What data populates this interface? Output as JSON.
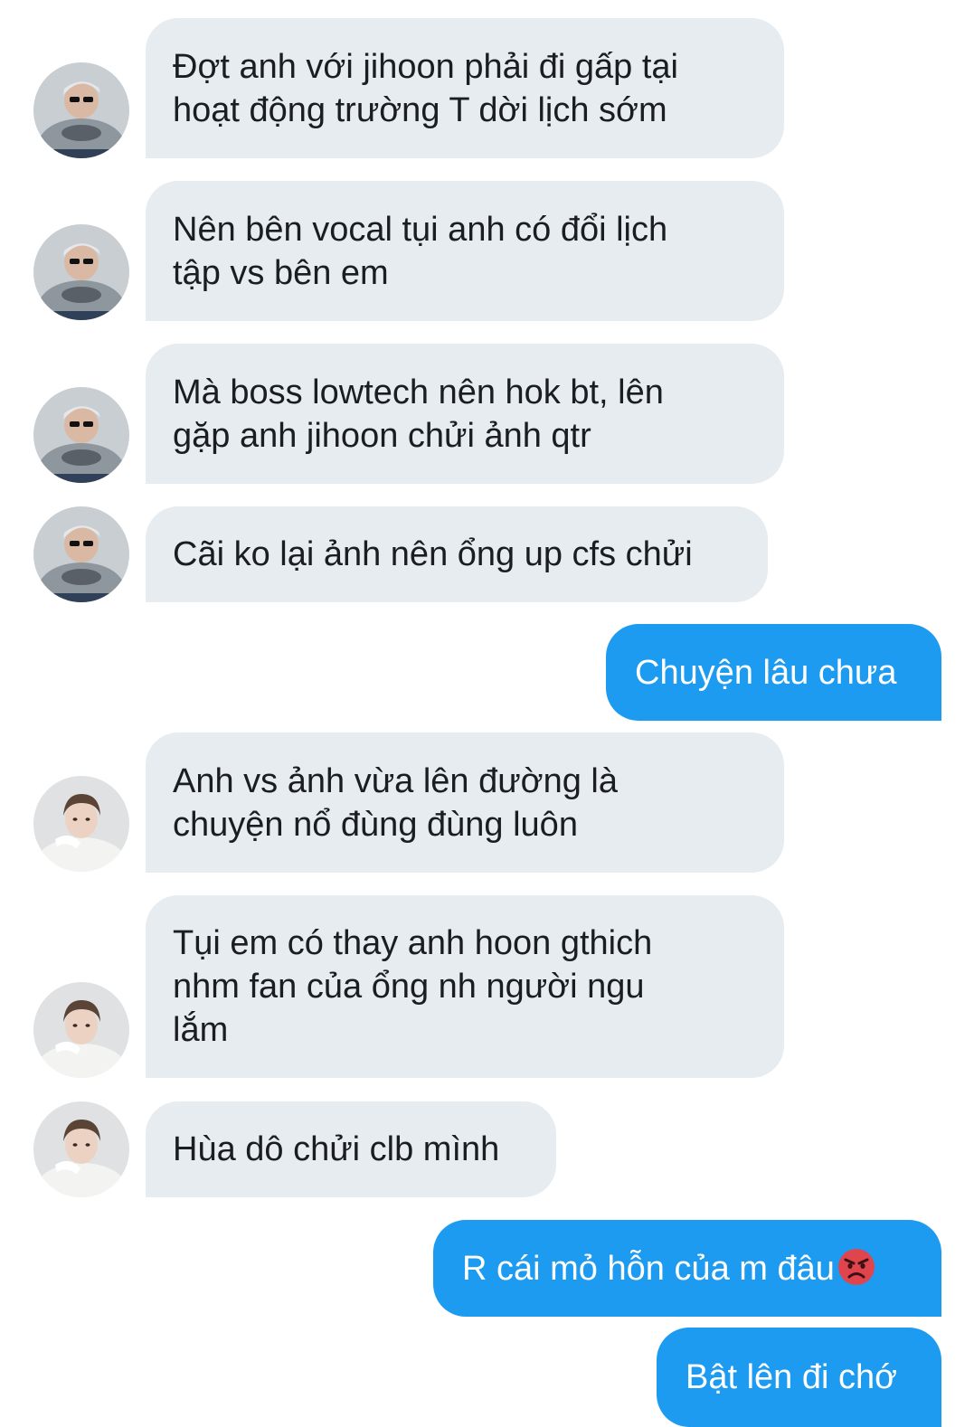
{
  "conversation": {
    "messages": [
      {
        "sender": "contact-a",
        "lines": [
          "Đợt anh với jihoon phải đi gấp tại",
          "hoạt động trường T dời lịch sớm"
        ]
      },
      {
        "sender": "contact-a",
        "lines": [
          "Nên bên vocal tụi anh có đổi lịch",
          "tập vs bên em"
        ]
      },
      {
        "sender": "contact-a",
        "lines": [
          "Mà boss lowtech nên hok bt, lên",
          "gặp anh jihoon chửi ảnh qtr"
        ]
      },
      {
        "sender": "contact-a",
        "lines": [
          "Cãi ko lại ảnh nên ổng up cfs chửi"
        ]
      },
      {
        "sender": "me",
        "lines": [
          "Chuyện lâu chưa"
        ]
      },
      {
        "sender": "contact-b",
        "lines": [
          "Anh vs ảnh vừa lên đường là",
          "chuyện nổ đùng đùng luôn"
        ]
      },
      {
        "sender": "contact-b",
        "lines": [
          "Tụi em có thay anh hoon gthich",
          "nhm fan của ổng nh người ngu",
          "lắm"
        ]
      },
      {
        "sender": "contact-b",
        "lines": [
          "Hùa dô chửi clb mình"
        ]
      },
      {
        "sender": "me",
        "lines": [
          "R cái mỏ hỗn của m đâu"
        ],
        "emoji": "angry-face-icon"
      },
      {
        "sender": "me",
        "lines": [
          "Bật lên đi chớ"
        ]
      }
    ]
  },
  "colors": {
    "received_bubble": "#e6ecf0",
    "sent_bubble": "#1d9bf0",
    "received_text": "#1a1d21",
    "sent_text": "#ffffff"
  }
}
